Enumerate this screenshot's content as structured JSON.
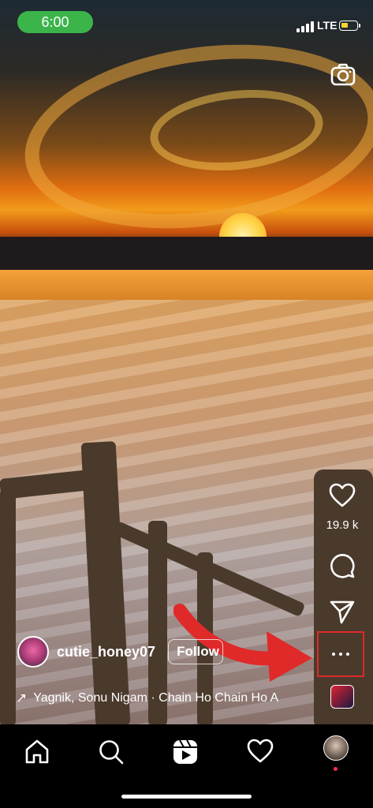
{
  "status_bar": {
    "time": "6:00",
    "network": "LTE",
    "battery_level": 0.45,
    "colors": {
      "time_pill": "#3bb54a",
      "battery": "#ffd230"
    }
  },
  "reel": {
    "camera_icon": "camera-icon",
    "actions": {
      "like_icon": "heart-icon",
      "like_count": "19.9 k",
      "comment_icon": "comment-icon",
      "share_icon": "send-icon",
      "more_icon": "more-dots-icon",
      "highlight_color": "#e02a2a"
    },
    "author": {
      "username": "cutie_honey07",
      "follow_label": "Follow"
    },
    "music": {
      "arrow_icon": "trending-arrow-icon",
      "text": "Yagnik, Sonu Nigam · Chain Ho Chain Ho A"
    }
  },
  "bottom_nav": {
    "items": [
      {
        "name": "home",
        "icon": "home-icon"
      },
      {
        "name": "search",
        "icon": "search-icon"
      },
      {
        "name": "reels",
        "icon": "reels-icon"
      },
      {
        "name": "activity",
        "icon": "heart-icon"
      },
      {
        "name": "profile",
        "icon": "avatar"
      }
    ]
  }
}
